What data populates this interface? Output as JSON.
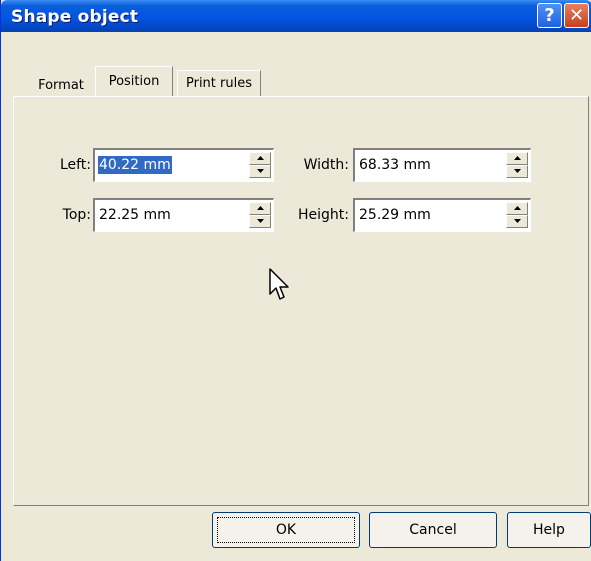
{
  "window": {
    "title": "Shape object",
    "help_icon": "help-icon",
    "close_icon": "close-icon",
    "help_glyph": "?",
    "close_glyph": "✕"
  },
  "tabs": [
    {
      "label": "Format",
      "active": false
    },
    {
      "label": "Position",
      "active": true
    },
    {
      "label": "Print rules",
      "active": false
    }
  ],
  "position": {
    "left": {
      "label": "Left:",
      "value": "40.22 mm",
      "selected": true
    },
    "top": {
      "label": "Top:",
      "value": "22.25 mm",
      "selected": false
    },
    "width": {
      "label": "Width:",
      "value": "68.33 mm",
      "selected": false
    },
    "height": {
      "label": "Height:",
      "value": "25.29 mm",
      "selected": false
    }
  },
  "buttons": {
    "ok": "OK",
    "cancel": "Cancel",
    "help": "Help"
  },
  "colors": {
    "titlebar": "#0554e3",
    "dialog_bg": "#ece9d8",
    "selection": "#316ac5"
  }
}
